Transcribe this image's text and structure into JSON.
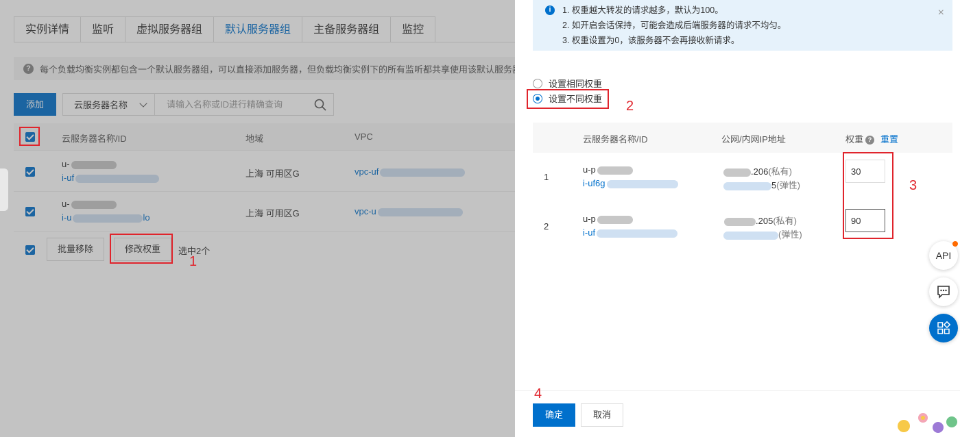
{
  "tabs": [
    "实例详情",
    "监听",
    "虚拟服务器组",
    "默认服务器组",
    "主备服务器组",
    "监控"
  ],
  "notice": "每个负载均衡实例都包含一个默认服务器组，可以直接添加服务器，但负载均衡实例下的所有监听都共享使用该默认服务器组",
  "toolbar": {
    "add_label": "添加",
    "filter_label": "云服务器名称",
    "search_placeholder": "请输入名称或ID进行精确查询"
  },
  "table": {
    "headers": [
      "云服务器名称/ID",
      "地域",
      "VPC"
    ],
    "rows": [
      {
        "name": "u-",
        "id": "i-uf",
        "region": "上海 可用区G",
        "vpc": "vpc-uf"
      },
      {
        "name": "u-",
        "id": "i-u",
        "id_tail": "lo",
        "region": "上海 可用区G",
        "vpc": "vpc-u"
      }
    ]
  },
  "bulk": {
    "remove_label": "批量移除",
    "modify_label": "修改权重",
    "selected_text": "选中2个"
  },
  "annotations": [
    "1",
    "2",
    "3",
    "4"
  ],
  "info": {
    "lines": [
      "1. 权重越大转发的请求越多，默认为100。",
      "2. 如开启会话保持，可能会造成后端服务器的请求不均匀。",
      "3. 权重设置为0，该服务器不会再接收新请求。"
    ],
    "close": "×"
  },
  "radios": {
    "same": "设置相同权重",
    "different": "设置不同权重",
    "selected": "different"
  },
  "weight_table": {
    "headers": {
      "server": "云服务器名称/ID",
      "ip": "公网/内网IP地址",
      "weight": "权重",
      "reset": "重置"
    },
    "rows": [
      {
        "index": "1",
        "name": "u-p",
        "id": "i-uf6g",
        "ip_private": ".206",
        "private_tag": "(私有)",
        "ip_public": "5",
        "public_tag": "(弹性)",
        "weight": "30"
      },
      {
        "index": "2",
        "name": "u-p",
        "id": "i-uf",
        "ip_private": ".205",
        "private_tag": "(私有)",
        "ip_public": "",
        "public_tag": "(弹性)",
        "weight": "90"
      }
    ]
  },
  "footer": {
    "ok_label": "确定",
    "cancel_label": "取消"
  },
  "float": {
    "api_label": "API"
  },
  "colors": {
    "accent": "#0070cc",
    "annotation": "#e0242c",
    "info_bg": "#e6f2fb"
  }
}
